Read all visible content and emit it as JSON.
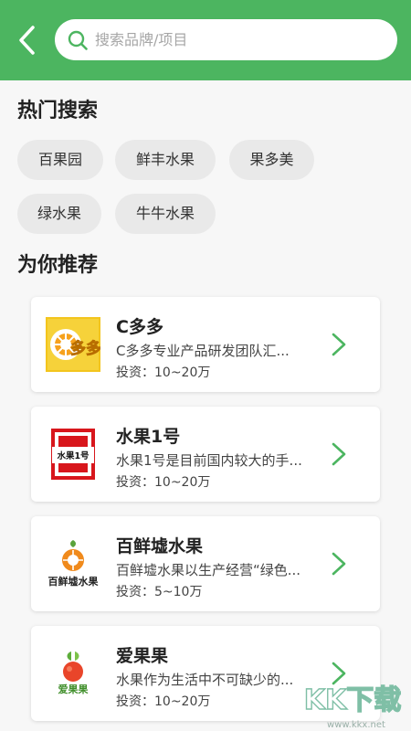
{
  "header": {
    "search_placeholder": "搜索品牌/项目",
    "accent_color": "#4cb560"
  },
  "hot_search": {
    "title": "热门搜索",
    "tags": [
      "百果园",
      "鲜丰水果",
      "果多美",
      "绿水果",
      "牛牛水果"
    ]
  },
  "recommend": {
    "title": "为你推荐",
    "items": [
      {
        "name": "C多多",
        "desc": "C多多专业产品研发团队汇...",
        "invest": "投资：10~20万",
        "logo_icon": "c-duoduo-logo-icon",
        "logo_text": "多多"
      },
      {
        "name": "水果1号",
        "desc": "水果1号是目前国内较大的手...",
        "invest": "投资：10~20万",
        "logo_icon": "shuiguo-1hao-logo-icon",
        "logo_text": "水果1号"
      },
      {
        "name": "百鲜墟水果",
        "desc": "百鲜墟水果以生产经营“绿色...",
        "invest": "投资：5~10万",
        "logo_icon": "baixianxu-logo-icon",
        "logo_text": "百鲜墟水果"
      },
      {
        "name": "爱果果",
        "desc": "水果作为生活中不可缺少的...",
        "invest": "投资：10~20万",
        "logo_icon": "aiguoguo-logo-icon",
        "logo_text": "爱果果"
      }
    ]
  },
  "watermark": {
    "text": "KK下载",
    "url_text": "www.kkx.net"
  }
}
